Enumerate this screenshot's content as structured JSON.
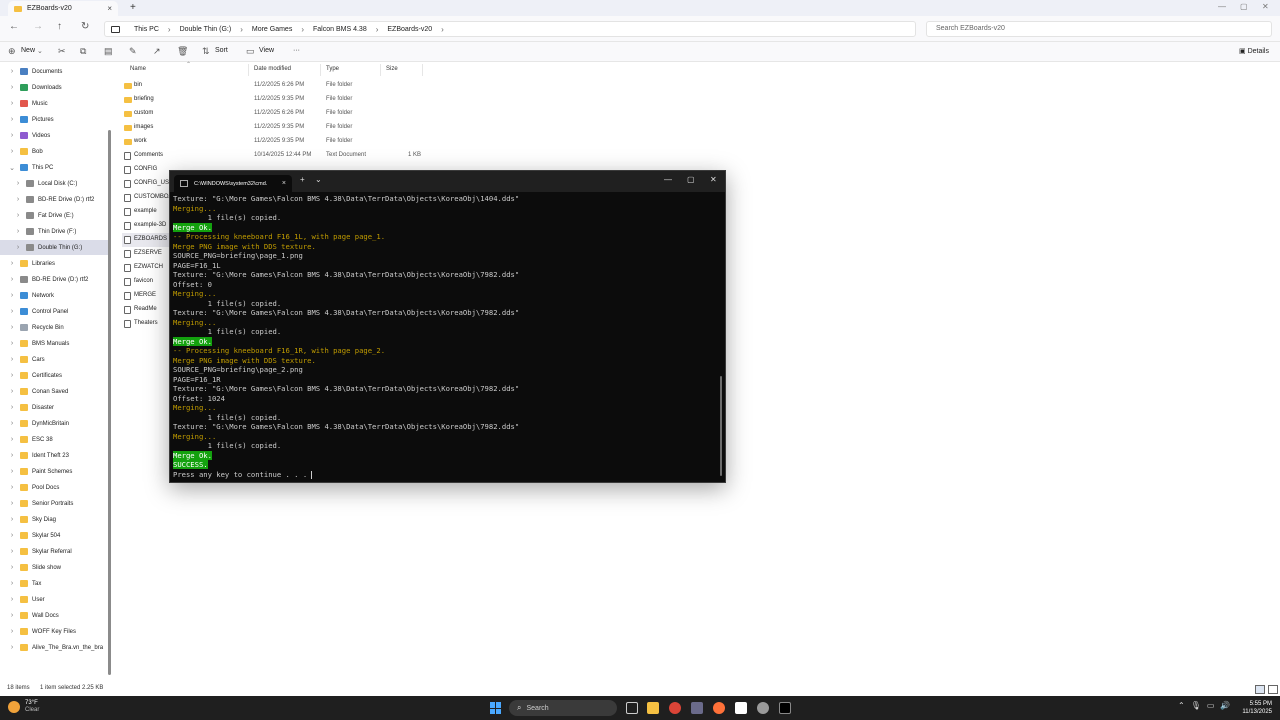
{
  "explorer": {
    "tab_title": "EZBoards-v20",
    "breadcrumbs": [
      "This PC",
      "Double Thin (G:)",
      "More Games",
      "Falcon BMS 4.38",
      "EZBoards-v20"
    ],
    "search_placeholder": "Search EZBoards-v20",
    "toolbar": {
      "new_label": "New",
      "sort_label": "Sort",
      "view_label": "View",
      "more_label": "···",
      "details_label": "Details"
    },
    "columns": {
      "name": "Name",
      "date": "Date modified",
      "type": "Type",
      "size": "Size"
    },
    "nav_items": [
      {
        "label": "Documents",
        "icon": "documents-icon",
        "color": "#4a7fc1"
      },
      {
        "label": "Downloads",
        "icon": "downloads-icon",
        "color": "#2e9e5b"
      },
      {
        "label": "Music",
        "icon": "music-icon",
        "color": "#e2574c"
      },
      {
        "label": "Pictures",
        "icon": "pictures-icon",
        "color": "#3c8dd6"
      },
      {
        "label": "Videos",
        "icon": "videos-icon",
        "color": "#8e5bd0"
      },
      {
        "label": "Bob",
        "icon": "folder-icon",
        "color": "#f5c042"
      },
      {
        "label": "This PC",
        "icon": "pc-icon",
        "color": "#3c8dd6"
      },
      {
        "label": "Local Disk (C:)",
        "icon": "drive-icon",
        "color": "#8a8a8a"
      },
      {
        "label": "BD-RE Drive (D:) rtf2",
        "icon": "disc-icon",
        "color": "#8a8a8a"
      },
      {
        "label": "Fat Drive (E:)",
        "icon": "drive-icon",
        "color": "#8a8a8a"
      },
      {
        "label": "Thin Drive (F:)",
        "icon": "drive-icon",
        "color": "#8a8a8a"
      },
      {
        "label": "Double Thin (G:)",
        "icon": "drive-icon",
        "color": "#8a8a8a"
      },
      {
        "label": "Libraries",
        "icon": "libraries-icon",
        "color": "#f5c042"
      },
      {
        "label": "BD-RE Drive (D:) rtf2",
        "icon": "disc-icon",
        "color": "#8a8a8a"
      },
      {
        "label": "Network",
        "icon": "network-icon",
        "color": "#3c8dd6"
      },
      {
        "label": "Control Panel",
        "icon": "control-panel-icon",
        "color": "#3c8dd6"
      },
      {
        "label": "Recycle Bin",
        "icon": "recycle-bin-icon",
        "color": "#9aa4b0"
      },
      {
        "label": "BMS Manuals",
        "icon": "folder-icon",
        "color": "#f5c042"
      },
      {
        "label": "Cars",
        "icon": "folder-icon",
        "color": "#f5c042"
      },
      {
        "label": "Certificates",
        "icon": "folder-icon",
        "color": "#f5c042"
      },
      {
        "label": "Conan Saved",
        "icon": "folder-icon",
        "color": "#f5c042"
      },
      {
        "label": "Disaster",
        "icon": "folder-icon",
        "color": "#f5c042"
      },
      {
        "label": "DynMicBritain",
        "icon": "folder-icon",
        "color": "#f5c042"
      },
      {
        "label": "ESC 38",
        "icon": "folder-icon",
        "color": "#f5c042"
      },
      {
        "label": "Ident Theft 23",
        "icon": "folder-icon",
        "color": "#f5c042"
      },
      {
        "label": "Paint Schemes",
        "icon": "folder-icon",
        "color": "#f5c042"
      },
      {
        "label": "Pool Docs",
        "icon": "folder-icon",
        "color": "#f5c042"
      },
      {
        "label": "Senior Portraits",
        "icon": "folder-icon",
        "color": "#f5c042"
      },
      {
        "label": "Sky Diag",
        "icon": "folder-icon",
        "color": "#f5c042"
      },
      {
        "label": "Skylar 504",
        "icon": "folder-icon",
        "color": "#f5c042"
      },
      {
        "label": "Skylar Referral",
        "icon": "folder-icon",
        "color": "#f5c042"
      },
      {
        "label": "Slide show",
        "icon": "folder-icon",
        "color": "#f5c042"
      },
      {
        "label": "Tax",
        "icon": "folder-icon",
        "color": "#f5c042"
      },
      {
        "label": "User",
        "icon": "folder-icon",
        "color": "#f5c042"
      },
      {
        "label": "Wall Docs",
        "icon": "folder-icon",
        "color": "#f5c042"
      },
      {
        "label": "WOFF Key Files",
        "icon": "folder-icon",
        "color": "#f5c042"
      },
      {
        "label": "Alive_The_Bra.vn_the_bra",
        "icon": "folder-icon",
        "color": "#f5c042"
      }
    ],
    "files": [
      {
        "name": "bin",
        "date": "11/2/2025 6:26 PM",
        "type": "File folder",
        "size": "",
        "kind": "folder"
      },
      {
        "name": "briefing",
        "date": "11/2/2025 9:35 PM",
        "type": "File folder",
        "size": "",
        "kind": "folder"
      },
      {
        "name": "custom",
        "date": "11/2/2025 6:26 PM",
        "type": "File folder",
        "size": "",
        "kind": "folder"
      },
      {
        "name": "images",
        "date": "11/2/2025 9:35 PM",
        "type": "File folder",
        "size": "",
        "kind": "folder"
      },
      {
        "name": "work",
        "date": "11/2/2025 9:35 PM",
        "type": "File folder",
        "size": "",
        "kind": "folder"
      },
      {
        "name": "Comments",
        "date": "10/14/2025 12:44 PM",
        "type": "Text Document",
        "size": "1 KB",
        "kind": "doc"
      },
      {
        "name": "CONFIG",
        "date": "",
        "type": "",
        "size": "",
        "kind": "doc"
      },
      {
        "name": "CONFIG_USE",
        "date": "",
        "type": "",
        "size": "",
        "kind": "doc"
      },
      {
        "name": "CUSTOMBOA",
        "date": "",
        "type": "",
        "size": "",
        "kind": "doc"
      },
      {
        "name": "example",
        "date": "",
        "type": "",
        "size": "",
        "kind": "doc"
      },
      {
        "name": "example-3D",
        "date": "",
        "type": "",
        "size": "",
        "kind": "doc"
      },
      {
        "name": "EZBOARDS",
        "date": "",
        "type": "",
        "size": "",
        "kind": "doc"
      },
      {
        "name": "EZSERVE",
        "date": "",
        "type": "",
        "size": "",
        "kind": "doc"
      },
      {
        "name": "EZWATCH",
        "date": "",
        "type": "",
        "size": "",
        "kind": "doc"
      },
      {
        "name": "favicon",
        "date": "",
        "type": "",
        "size": "",
        "kind": "doc"
      },
      {
        "name": "MERGE",
        "date": "",
        "type": "",
        "size": "",
        "kind": "doc"
      },
      {
        "name": "ReadMe",
        "date": "",
        "type": "",
        "size": "",
        "kind": "doc"
      },
      {
        "name": "Theaters",
        "date": "",
        "type": "",
        "size": "",
        "kind": "doc"
      }
    ],
    "status": {
      "items": "18 items",
      "selected": "1 item selected  2.25 KB"
    }
  },
  "terminal": {
    "tab_title": "C:\\WINDOWS\\system32\\cmd.",
    "lines": [
      {
        "text": "Texture: \"G:\\More Games\\Falcon BMS 4.38\\Data\\TerrData\\Objects\\KoreaObj\\1404.dds\"",
        "style": "w"
      },
      {
        "text": "Merging...",
        "style": "y"
      },
      {
        "text": "        1 file(s) copied.",
        "style": "w"
      },
      {
        "text": "Merge Ok.",
        "style": "hl"
      },
      {
        "text": "-- Processing kneeboard F16_1L, with page page_1.",
        "style": "y"
      },
      {
        "text": "Merge PNG image with DDS texture.",
        "style": "y"
      },
      {
        "text": "SOURCE_PNG=briefing\\page_1.png",
        "style": "w"
      },
      {
        "text": "PAGE=F16_1L",
        "style": "w"
      },
      {
        "text": "Texture: \"G:\\More Games\\Falcon BMS 4.38\\Data\\TerrData\\Objects\\KoreaObj\\7982.dds\"",
        "style": "w"
      },
      {
        "text": "Offset: 0",
        "style": "w"
      },
      {
        "text": "Merging...",
        "style": "y"
      },
      {
        "text": "        1 file(s) copied.",
        "style": "w"
      },
      {
        "text": "Texture: \"G:\\More Games\\Falcon BMS 4.38\\Data\\TerrData\\Objects\\KoreaObj\\7982.dds\"",
        "style": "w"
      },
      {
        "text": "Merging...",
        "style": "y"
      },
      {
        "text": "        1 file(s) copied.",
        "style": "w"
      },
      {
        "text": "Merge Ok.",
        "style": "hl"
      },
      {
        "text": "-- Processing kneeboard F16_1R, with page page_2.",
        "style": "y"
      },
      {
        "text": "Merge PNG image with DDS texture.",
        "style": "y"
      },
      {
        "text": "SOURCE_PNG=briefing\\page_2.png",
        "style": "w"
      },
      {
        "text": "PAGE=F16_1R",
        "style": "w"
      },
      {
        "text": "Texture: \"G:\\More Games\\Falcon BMS 4.38\\Data\\TerrData\\Objects\\KoreaObj\\7982.dds\"",
        "style": "w"
      },
      {
        "text": "Offset: 1024",
        "style": "w"
      },
      {
        "text": "Merging...",
        "style": "y"
      },
      {
        "text": "        1 file(s) copied.",
        "style": "w"
      },
      {
        "text": "Texture: \"G:\\More Games\\Falcon BMS 4.38\\Data\\TerrData\\Objects\\KoreaObj\\7982.dds\"",
        "style": "w"
      },
      {
        "text": "Merging...",
        "style": "y"
      },
      {
        "text": "        1 file(s) copied.",
        "style": "w"
      },
      {
        "text": "Merge Ok.",
        "style": "hl"
      },
      {
        "text": "SUCCESS.",
        "style": "hl"
      },
      {
        "text": "Press any key to continue . . . ",
        "style": "w"
      }
    ]
  },
  "taskbar": {
    "weather_temp": "73°F",
    "weather_desc": "Clear",
    "search_label": "Search",
    "time": "5:55 PM",
    "date": "11/13/2025"
  },
  "colors": {
    "folder": "#f5c042",
    "terminal_bg": "#0c0c0c",
    "terminal_yellow": "#c19c00",
    "terminal_highlight": "#13a10e",
    "selection": "#dadce8"
  }
}
